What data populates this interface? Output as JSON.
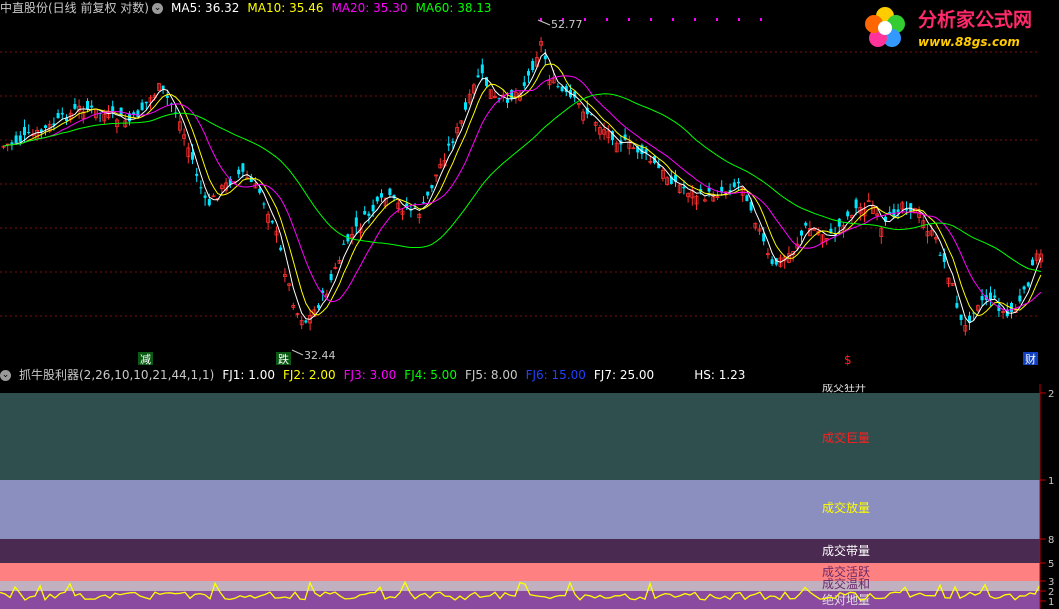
{
  "main_header": {
    "title": "中直股份(日线 前复权 对数)",
    "ma5": "MA5: 36.32",
    "ma10": "MA10: 35.46",
    "ma20": "MA20: 35.30",
    "ma60": "MA60: 38.13",
    "colors": {
      "title": "#c8c8c8",
      "ma5": "#ffffff",
      "ma10": "#ffff00",
      "ma20": "#ff00ff",
      "ma60": "#00ff00"
    }
  },
  "indicator_header": {
    "title": "抓牛股利器(2,26,10,10,21,44,1,1)",
    "fj1": "FJ1: 1.00",
    "fj2": "FJ2: 2.00",
    "fj3": "FJ3: 3.00",
    "fj4": "FJ4: 5.00",
    "fj5": "FJ5: 8.00",
    "fj6": "FJ6: 15.00",
    "fj7": "FJ7: 25.00",
    "hs": "HS: 1.23",
    "colors": {
      "title": "#c8c8c8",
      "fj1": "#ffffff",
      "fj2": "#ffff00",
      "fj3": "#ff00ff",
      "fj4": "#00ff00",
      "fj5": "#c8c8c8",
      "fj6": "#0000ff",
      "fj7": "#ffffff",
      "hs": "#ffffff"
    }
  },
  "logo": {
    "title": "分析家公式网",
    "url": "www.88gs.com"
  },
  "price_labels": {
    "high": "52.77",
    "low": "32.44"
  },
  "signals": {
    "jian": "减",
    "die": "跌",
    "dollar": "$",
    "cai": "财"
  },
  "bands": {
    "label_top": "成交狂升",
    "label_huge": "成交巨量",
    "label_fang": "成交放量",
    "label_dai": "成交带量",
    "label_active": "成交活跃",
    "label_mild": "成交温和",
    "label_low": "绝对地量"
  },
  "axis_right": {
    "t2": "2",
    "t1": "1",
    "t8": "8",
    "t5": "5",
    "t3": "3",
    "t2b": "2",
    "t1b": "1"
  },
  "chart_data": {
    "type": "candlestick",
    "title": "中直股份(日线 前复权 对数)",
    "high_marker": 52.77,
    "low_marker": 32.44,
    "ma_latest": {
      "MA5": 36.32,
      "MA10": 35.46,
      "MA20": 35.3,
      "MA60": 38.13
    },
    "indicator_latest": {
      "FJ1": 1.0,
      "FJ2": 2.0,
      "FJ3": 3.0,
      "FJ4": 5.0,
      "FJ5": 8.0,
      "FJ6": 15.0,
      "FJ7": 25.0,
      "HS": 1.23
    },
    "band_colors": {
      "top": "#2f4f4f",
      "huge": "#2f4f4f",
      "fang": "#8a8fbf",
      "dai": "#4a2a50",
      "active": "#ff8080",
      "mild": "#c0b0c0",
      "low": "#8a4aa0"
    }
  }
}
